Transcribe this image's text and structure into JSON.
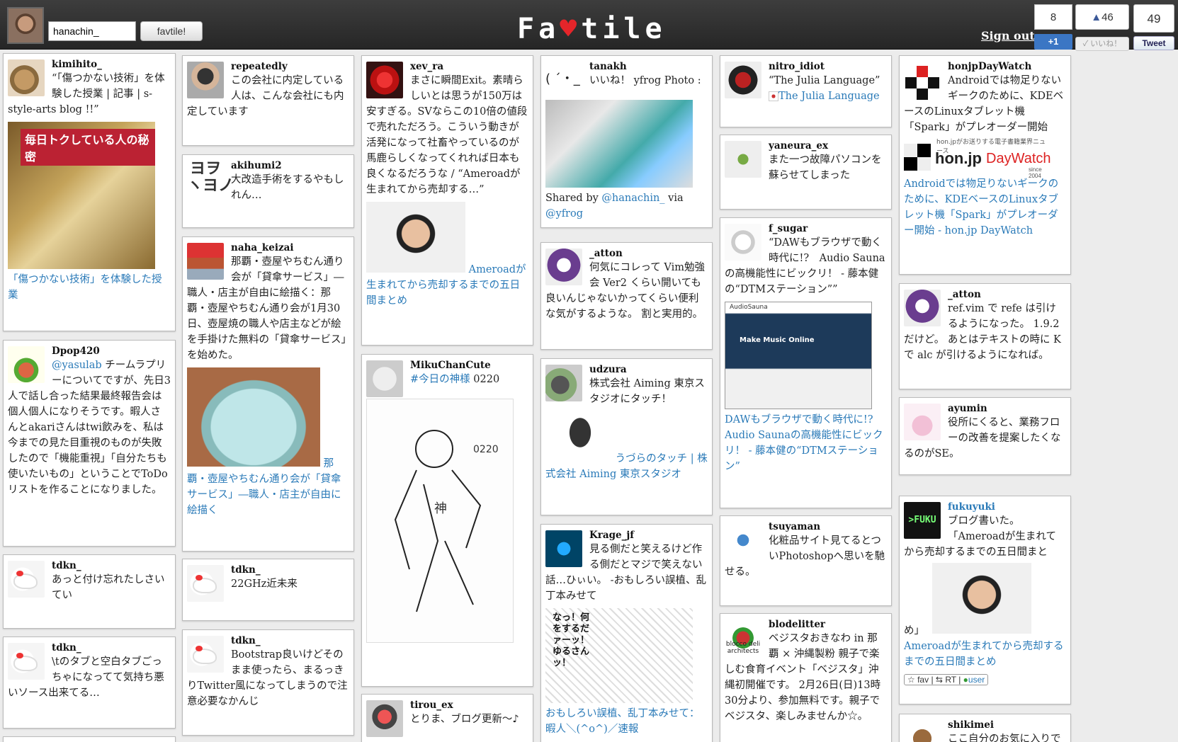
{
  "header": {
    "username_value": "hanachin_",
    "fav_button": "favtile!",
    "logo_pre": "Fa",
    "logo_heart": "♥",
    "logo_post": "tile",
    "signout": "Sign out",
    "gplus_count": "8",
    "gplus_label": "+1",
    "like_count": "46",
    "like_label": "✓ いいね！",
    "tweet_count": "49",
    "tweet_label": "Tweet"
  },
  "tiles": [
    {
      "id": "t1",
      "name": "kimihito_",
      "text": "“「傷つかない技術」を体験した授業 | 記事 | s-style-arts blog !!”",
      "pic_label": "毎日トクしている人の秘密",
      "link": "「傷つかない技術」を体験した授業"
    },
    {
      "id": "t2",
      "name": "Dpop420",
      "link_pre": "@yasulab",
      "text": " チームラプリーについてですが、先日3人で話し合った結果最終報告会は個人個人になりそうです。暇人さんとakariさんはtwi飲みを、私は今までの見た目重視のものが失敗したので「機能重視」「自分たちも使いたいもの」ということでToDoリストを作ることになりました。"
    },
    {
      "id": "t3",
      "name": "tdkn_",
      "text": "あっと付け忘れたしさいてい"
    },
    {
      "id": "t4",
      "name": "tdkn_",
      "text": "\\tのタブと空白タブごっちゃになってて気持ち悪いソース出来てる…"
    },
    {
      "id": "t5",
      "name": "repeatedly",
      "text": "この会社に内定している人は、こんな会社にも内定しています"
    },
    {
      "id": "t6",
      "name": "akihumi2",
      "text": "大改造手術をするやもしれん…",
      "avatar_text": "ヨヲ\nヽヨノ"
    },
    {
      "id": "t7",
      "name": "naha_keizai",
      "text": "那覇・壺屋やちむん通り会が「貸傘サービス」―職人・店主が自由に絵描く：那覇・壺屋やちむん通り会が1月30日、壺屋焼の職人や店主などが絵を手掛けた無料の「貸傘サービス」を始めた。",
      "link": "那覇・壺屋やちむん通り会が「貸傘サービス」―職人・店主が自由に絵描く"
    },
    {
      "id": "t8",
      "name": "tdkn_",
      "text": "22GHz近未来"
    },
    {
      "id": "t9",
      "name": "tdkn_",
      "text": "Bootstrap良いけどそのまま使ったら、まるっきりTwitter風になってしまうので注意必要なかんじ"
    },
    {
      "id": "t10",
      "name": "xev_ra",
      "text": "まさに瞬間Exit。素晴らしいとは思うが150万は安すぎる。SVならこの10倍の値段で売れただろう。こういう動きが活発になって社畜やっているのが馬鹿らしくなってくれれば日本も良くなるだろうな / “Ameroadが生まれてから売却する…”",
      "link": "Ameroadが生まれてから売却するまでの五日間まとめ"
    },
    {
      "id": "t11",
      "name": "MikuChanCute",
      "link_pre": "#今日の神様",
      "text": " 0220",
      "sketch_label": "0220",
      "sketch_char": "神"
    },
    {
      "id": "t12",
      "name": "tirou_ex",
      "text": "とりま、ブログ更新～♪"
    },
    {
      "id": "t13",
      "name": "tanakh",
      "avatar_text": "( ´・_",
      "text": "いいね！ yfrog Photo :",
      "shared_pre": "Shared by ",
      "shared_user": "@hanachin_",
      "shared_via": " via ",
      "shared_src": "@yfrog"
    },
    {
      "id": "t14",
      "name": "_atton",
      "text": "何気にコレって Vim勉強会 Ver2 くらい開いても良いんじゃないかってくらい便利な気がするような。 割と実用的。"
    },
    {
      "id": "t15",
      "name": "udzura",
      "text": "株式会社 Aiming 東京スタジオにタッチ！",
      "link": "うづらのタッチ | 株式会社 Aiming 東京スタジオ"
    },
    {
      "id": "t16",
      "name": "Krage_jf",
      "text": "見る側だと笑えるけど作る側だとマジで笑えない話…ひぃい。 -おもしろい誤植、乱丁本みせて",
      "link": "おもしろい誤植、乱丁本みせて：暇人＼(^o^)／速報",
      "manga_text": "なっ！何をするだァーッ！ゆるさんッ！"
    },
    {
      "id": "t17",
      "name": "nitro_idiot",
      "text": "“The Julia Language”",
      "link": "The Julia Language"
    },
    {
      "id": "t18",
      "name": "yaneura_ex",
      "text": "また一つ故障パソコンを蘇らせてしまった"
    },
    {
      "id": "t19",
      "name": "f_sugar",
      "text": "“DAWもブラウザで動く時代に!?　Audio Saunaの高機能性にビックリ！ - 藤本健の“DTMステーション””",
      "link": "DAWもブラウザで動く時代に!? Audio Saunaの高機能性にビックリ！ - 藤本健の“DTMステーション”",
      "shot_title": "AudioSauna",
      "shot_head": "Make Music Online"
    },
    {
      "id": "t20",
      "name": "tsuyaman",
      "text": "化粧品サイト見てるとついPhotoshopへ思いを馳せる。"
    },
    {
      "id": "t21",
      "name": "blodelitter",
      "text": "ベジスタおきなわ in 那覇 × 沖縄製粉 親子で楽しむ食育イベント「ベジスタ」沖縄初開催です。 2月26日(日)13時30分より、参加無料です。親子でベジスタ、楽しみませんか☆。",
      "logo_text": "blocco deli\narchitects"
    },
    {
      "id": "t22",
      "name": "honjpDayWatch",
      "text": "Androidでは物足りないギークのために、KDEベースのLinuxタブレット機「Spark」がプレオーダー開始",
      "pic_caption": "hon.jpがお送りする電子書籍業界ニュース",
      "pic_brand": "hon.jp",
      "pic_brand2": "DayWatch",
      "pic_since": "since 2004",
      "link": "Androidでは物足りないギークのために、KDEベースのLinuxタブレット機「Spark」がプレオーダー開始 - hon.jp DayWatch"
    },
    {
      "id": "t23",
      "name": "_atton",
      "text": "ref.vim で refe は引けるようになった。 1.9.2 だけど。 あとはテキストの時に K で alc が引けるようになれば。"
    },
    {
      "id": "t24",
      "name": "ayumin",
      "text": "役所にくると、業務フローの改善を提案したくなるのがSE。"
    },
    {
      "id": "t25",
      "name": "fukuyuki",
      "text": "ブログ書いた。 「Ameroadが生まれてから売却するまでの五日間まとめ」",
      "link": "Ameroadが生まれてから売却するまでの五日間まとめ",
      "avatar_text": ">FUKU",
      "tag_fav": "☆ fav",
      "tag_rt": "RT",
      "tag_user": "user"
    },
    {
      "id": "t26",
      "name": "shikimei",
      "text": "ここ自分のお気に入りで"
    }
  ],
  "colors": {
    "link": "#2a7ab8",
    "topbar": "#2f2f2f",
    "heart": "#e5252a"
  },
  "icons": [
    "search-icon",
    "heart-icon",
    "gplus-icon",
    "like-icon",
    "tweet-icon"
  ]
}
